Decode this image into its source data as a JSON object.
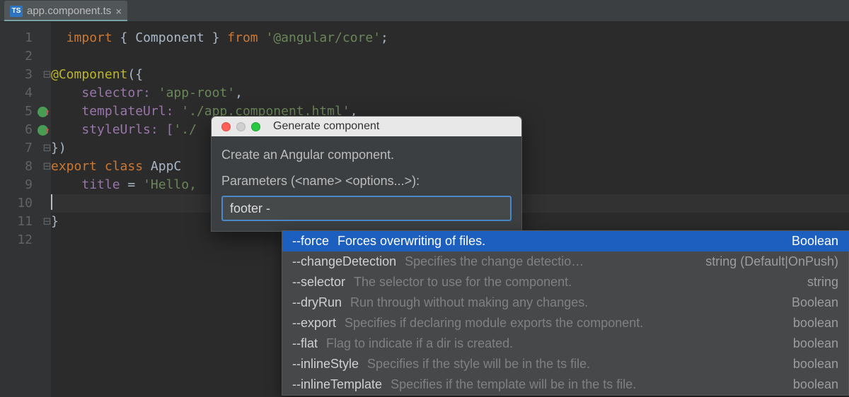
{
  "tab": {
    "icon_text": "TS",
    "filename": "app.component.ts"
  },
  "gutter": {
    "lines": [
      "1",
      "2",
      "3",
      "4",
      "5",
      "6",
      "7",
      "8",
      "9",
      "10",
      "11",
      "12"
    ],
    "marks": {
      "5": true,
      "6": true
    }
  },
  "code": {
    "l1_kw1": "import",
    "l1_sym1": " { ",
    "l1_id": "Component",
    "l1_sym2": " } ",
    "l1_kw2": "from ",
    "l1_str": "'@angular/core'",
    "l1_semi": ";",
    "l3_ann": "@Component",
    "l3_par": "({",
    "l4_prop": "selector: ",
    "l4_str": "'app-root'",
    "l4_c": ",",
    "l5_prop": "templateUrl: ",
    "l5_str": "'./app.component.html'",
    "l5_c": ",",
    "l6_prop": "styleUrls: [",
    "l6_str": "'./",
    "l7": "})",
    "l8_kw1": "export ",
    "l8_kw2": "class ",
    "l8_cls": "AppC",
    "l9_prop": "title ",
    "l9_eq": "= ",
    "l9_str": "'Hello,",
    "l11": "}"
  },
  "dialog": {
    "title": "Generate component",
    "desc": "Create an Angular component.",
    "param_label": "Parameters (<name> <options...>):",
    "input_value": "footer -"
  },
  "popup": {
    "items": [
      {
        "flag": "--force",
        "desc": "Forces overwriting of files.",
        "type": "Boolean",
        "sel": true
      },
      {
        "flag": "--changeDetection",
        "desc": "Specifies the change detectio…",
        "type": "string (Default|OnPush)"
      },
      {
        "flag": "--selector",
        "desc": "The selector to use for the component.",
        "type": "string"
      },
      {
        "flag": "--dryRun",
        "desc": "Run through without making any changes.",
        "type": "Boolean"
      },
      {
        "flag": "--export",
        "desc": "Specifies if declaring module exports the component.",
        "type": "boolean"
      },
      {
        "flag": "--flat",
        "desc": "Flag to indicate if a dir is created.",
        "type": "boolean"
      },
      {
        "flag": "--inlineStyle",
        "desc": "Specifies if the style will be in the ts file.",
        "type": "boolean"
      },
      {
        "flag": "--inlineTemplate",
        "desc": "Specifies if the template will be in the ts file.",
        "type": "boolean"
      }
    ]
  }
}
